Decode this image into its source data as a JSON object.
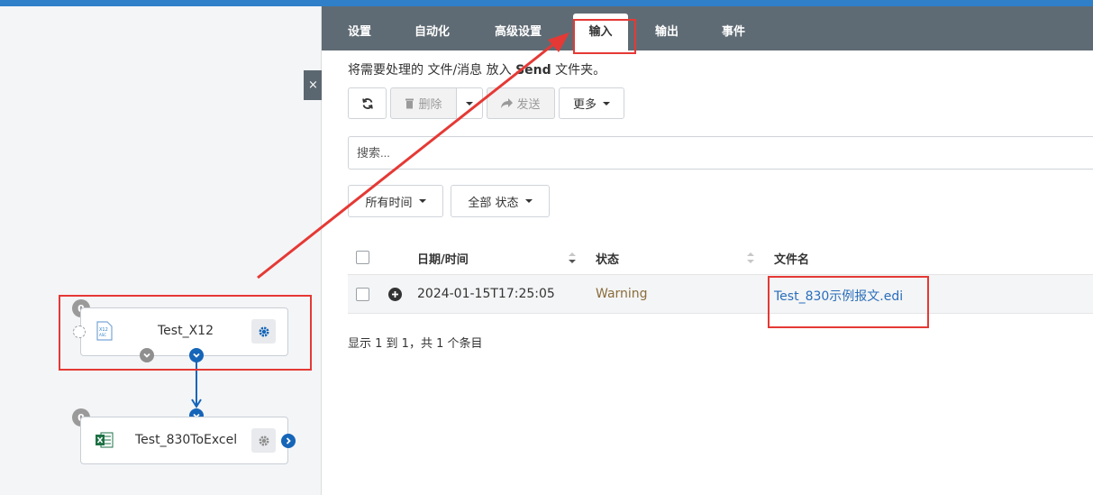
{
  "tabs": [
    {
      "label": "设置"
    },
    {
      "label": "自动化"
    },
    {
      "label": "高级设置"
    },
    {
      "label": "输入"
    },
    {
      "label": "输出"
    },
    {
      "label": "事件"
    }
  ],
  "active_tab": "输入",
  "close_label": "×",
  "description": {
    "prefix": "将需要处理的 文件/消息 放入 ",
    "bold": "Send",
    "suffix": " 文件夹。"
  },
  "toolbar": {
    "delete_label": "删除",
    "send_label": "发送",
    "more_label": "更多"
  },
  "search": {
    "placeholder": "搜索..."
  },
  "filters": {
    "time_label": "所有时间",
    "status_label": "全部 状态"
  },
  "table": {
    "headers": {
      "datetime": "日期/时间",
      "status": "状态",
      "filename": "文件名"
    },
    "rows": [
      {
        "datetime": "2024-01-15T17:25:05",
        "status": "Warning",
        "filename": "Test_830示例报文.edi"
      }
    ]
  },
  "footer": "显示 1 到 1，共 1 个条目",
  "flow": {
    "node1": {
      "label": "Test_X12",
      "badge": "0"
    },
    "node2": {
      "label": "Test_830ToExcel",
      "badge": "0"
    }
  },
  "colors": {
    "accent": "#2f80c9",
    "tabbar": "#5f6b74",
    "highlight": "#e53935",
    "link": "#2a6ebb",
    "warning": "#8a6d3b"
  }
}
